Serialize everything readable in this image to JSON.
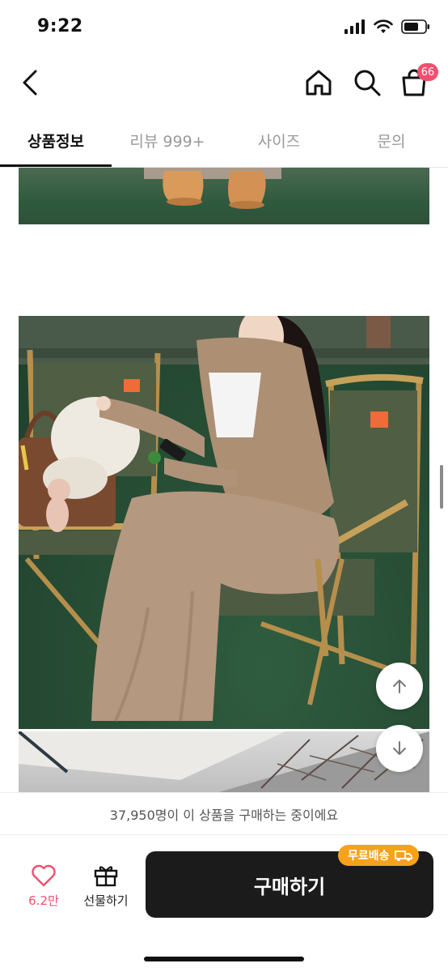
{
  "status_bar": {
    "time": "9:22"
  },
  "header": {
    "cart_count": "66"
  },
  "tabs": [
    {
      "label": "상품정보",
      "active": true
    },
    {
      "label": "리뷰 999+",
      "active": false
    },
    {
      "label": "사이즈",
      "active": false
    },
    {
      "label": "문의",
      "active": false
    }
  ],
  "purchase_info": "37,950명이 이 상품을 구매하는 중이에요",
  "bottom_bar": {
    "like_count": "6.2만",
    "gift_label": "선물하기",
    "buy_label": "구매하기",
    "free_shipping_badge": "무료배송"
  },
  "colors": {
    "accent_pink": "#f0506e",
    "badge_orange": "#f7a21b",
    "buy_button": "#1b1b1b"
  }
}
